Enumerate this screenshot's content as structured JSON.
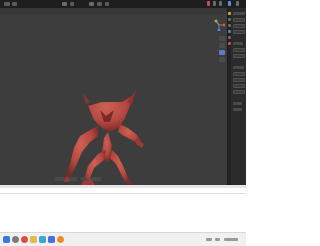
{
  "app": {
    "accent_color": "#5680c2",
    "viewport_color": "#3d3d3d",
    "panel_color": "#2b2b2b"
  },
  "viewport": {
    "model": "creature sculpt",
    "model_color": "#b4473f"
  },
  "gizmo": {
    "axes": [
      {
        "name": "x-axis",
        "color": "#e4544d"
      },
      {
        "name": "y-axis",
        "color": "#8bc34a"
      },
      {
        "name": "z-axis",
        "color": "#4a8be4"
      }
    ]
  },
  "taskbar": {
    "icons": [
      {
        "name": "windows-icon",
        "color": "#3a7bd5"
      },
      {
        "name": "search-icon",
        "color": "#7a7a7a"
      },
      {
        "name": "chrome-icon",
        "color": "#e04b3a"
      },
      {
        "name": "folder-icon",
        "color": "#e8b84a"
      },
      {
        "name": "app-icon",
        "color": "#3aa7d8"
      },
      {
        "name": "store-icon",
        "color": "#4a6fd8"
      },
      {
        "name": "blender-icon",
        "color": "#f08a24"
      }
    ]
  }
}
